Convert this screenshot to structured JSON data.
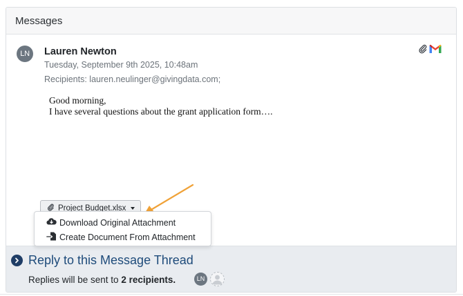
{
  "panel": {
    "title": "Messages"
  },
  "message": {
    "avatar_initials": "LN",
    "sender": "Lauren Newton",
    "date": "Tuesday, September 9th 2025, 10:48am",
    "recipients": "Recipients: lauren.neulinger@givingdata.com;",
    "body_lines": [
      "Good morning,",
      "I have several questions about the grant application form…."
    ],
    "icons": [
      "paperclip-icon",
      "gmail-icon"
    ]
  },
  "attachment": {
    "label": "Project Budget.xlsx",
    "menu": [
      "Download Original Attachment",
      "Create Document From Attachment"
    ]
  },
  "reply": {
    "title": "Reply to this Message Thread",
    "sub_prefix": "Replies will be sent to ",
    "sub_count": "2 recipients.",
    "avatar_initials": "LN"
  },
  "colors": {
    "accent": "#1e4b7a",
    "arrow": "#f0a238",
    "avatar": "#6c7680",
    "reply_bg": "#e9ecf0"
  }
}
